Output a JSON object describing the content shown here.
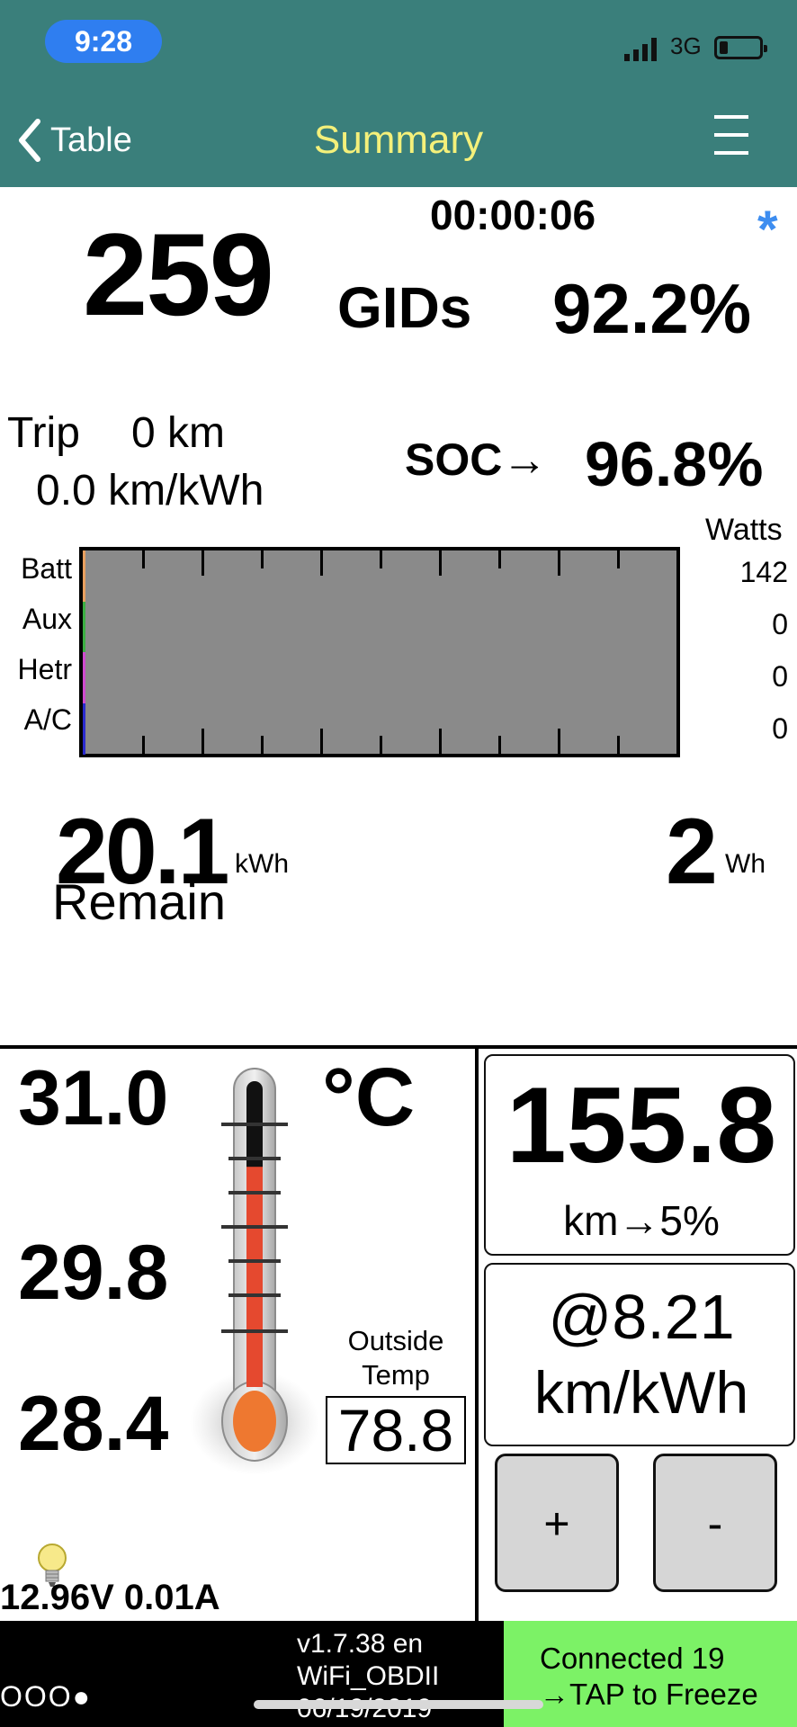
{
  "status_bar": {
    "time": "9:28",
    "network": "3G"
  },
  "nav": {
    "back_label": "Table",
    "title": "Summary"
  },
  "summary": {
    "gids": "259",
    "gids_label": "GIDs",
    "gids_percent": "92.2%",
    "timer": "00:00:06",
    "asterisk": "*",
    "trip_label": "Trip",
    "trip_distance": "0 km",
    "trip_efficiency": "0.0 km/kWh",
    "soc_label": "SOC→",
    "soc_value": "96.8%"
  },
  "power_bars": {
    "watts_label": "Watts",
    "rows": [
      {
        "label": "Batt",
        "watts": "142",
        "color": "#e8a060"
      },
      {
        "label": "Aux",
        "watts": "0",
        "color": "#3cb043"
      },
      {
        "label": "Hetr",
        "watts": "0",
        "color": "#d04ad0"
      },
      {
        "label": "A/C",
        "watts": "0",
        "color": "#2a2ad0"
      }
    ]
  },
  "energy": {
    "remain_value": "20.1",
    "remain_unit": "kWh",
    "remain_label": "Remain",
    "used_value": "2",
    "used_unit": "Wh"
  },
  "temperature": {
    "high": "31.0",
    "mid": "29.8",
    "low": "28.4",
    "unit": "°C",
    "outside_label_1": "Outside",
    "outside_label_2": "Temp",
    "outside_value": "78.8",
    "fill_fraction": 0.72
  },
  "electrical": {
    "readout": "12.96V 0.01A"
  },
  "range": {
    "value": "155.8",
    "unit": "km→5%",
    "efficiency_top": "@8.21",
    "efficiency_bottom": "km/kWh",
    "plus_label": "+",
    "minus_label": "-"
  },
  "footer": {
    "dots": "OOO●",
    "version_line1": "v1.7.38 en",
    "version_line2": "WiFi_OBDII",
    "version_line3": "06/19/2019",
    "connected_line1": "Connected 19",
    "connected_line2": "→TAP to Freeze"
  },
  "colors": {
    "header_bg": "#3a7f7b",
    "title": "#f4f07a",
    "time_pill": "#2f7ef0",
    "connected_bg": "#7cf266",
    "asterisk": "#3d8df0"
  }
}
